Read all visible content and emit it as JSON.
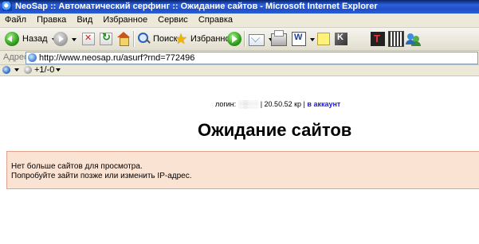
{
  "window": {
    "title": "NeoSap :: Автоматический серфинг :: Ожидание сайтов - Microsoft Internet Explorer"
  },
  "menu": [
    "Файл",
    "Правка",
    "Вид",
    "Избранное",
    "Сервис",
    "Справка"
  ],
  "toolbar": {
    "back_label": "Назад",
    "search_label": "Поиск",
    "favorites_label": "Избранное"
  },
  "address": {
    "label": "Адрес:",
    "url": "http://www.neosap.ru/asurf?rnd=772496"
  },
  "links_toolbar": {
    "counter": "+1/-0"
  },
  "page": {
    "login_label": "логин:",
    "login_value": "░▒░░",
    "separator": "|",
    "balance": "20.50.52 кр",
    "account_link": "в аккаунт",
    "title": "Ожидание сайтов",
    "notice_line1": "Нет больше сайтов для просмотра.",
    "notice_line2": "Попробуйте зайти позже или изменить IP-адрес."
  },
  "colors": {
    "titlebar": "#2c5fd8",
    "notice_bg": "#fbe3d4",
    "notice_border": "#e0a48c",
    "link": "#1d1ad6"
  }
}
